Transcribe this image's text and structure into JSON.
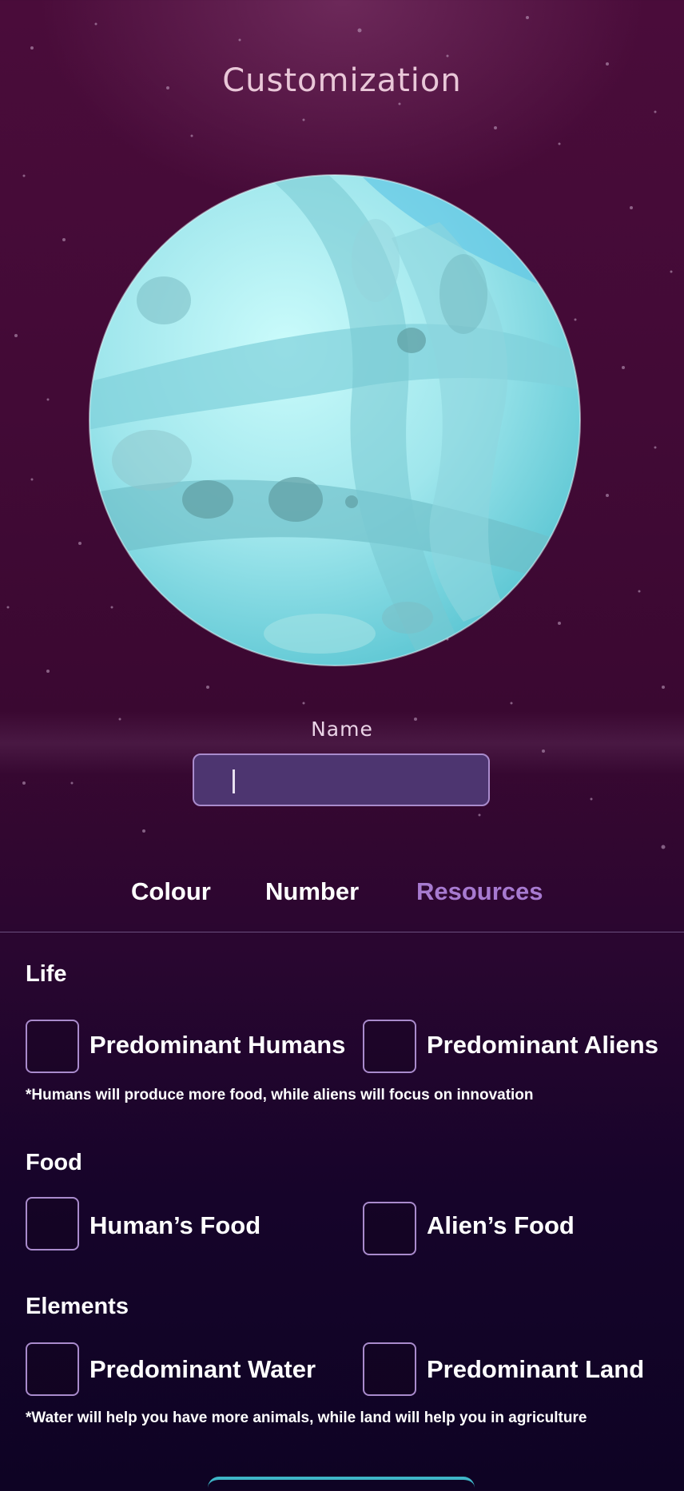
{
  "header": {
    "title": "Customization"
  },
  "name_field": {
    "label": "Name",
    "value": "",
    "placeholder": ""
  },
  "tabs": [
    {
      "label": "Colour",
      "active": false
    },
    {
      "label": "Number",
      "active": false
    },
    {
      "label": "Resources",
      "active": true
    }
  ],
  "sections": {
    "life": {
      "title": "Life",
      "options": [
        {
          "label": "Predominant Humans",
          "checked": false
        },
        {
          "label": "Predominant Aliens",
          "checked": false
        }
      ],
      "note": "*Humans will produce more food, while aliens will focus on innovation"
    },
    "food": {
      "title": "Food",
      "options": [
        {
          "label": "Human’s Food",
          "checked": false
        },
        {
          "label": "Alien’s Food",
          "checked": false
        }
      ]
    },
    "elements": {
      "title": "Elements",
      "options": [
        {
          "label": "Predominant Water",
          "checked": false
        },
        {
          "label": "Predominant Land",
          "checked": false
        }
      ],
      "note": "*Water will help you have more animals, while land will help you in agriculture"
    }
  },
  "colors": {
    "accent": "#a77ad0",
    "checkbox_border": "#a98bcc",
    "planet_light": "#bff5f7",
    "planet_mid": "#7fd3dc",
    "planet_dark": "#5fb6bf",
    "button_teal": "#3fb6c8"
  }
}
